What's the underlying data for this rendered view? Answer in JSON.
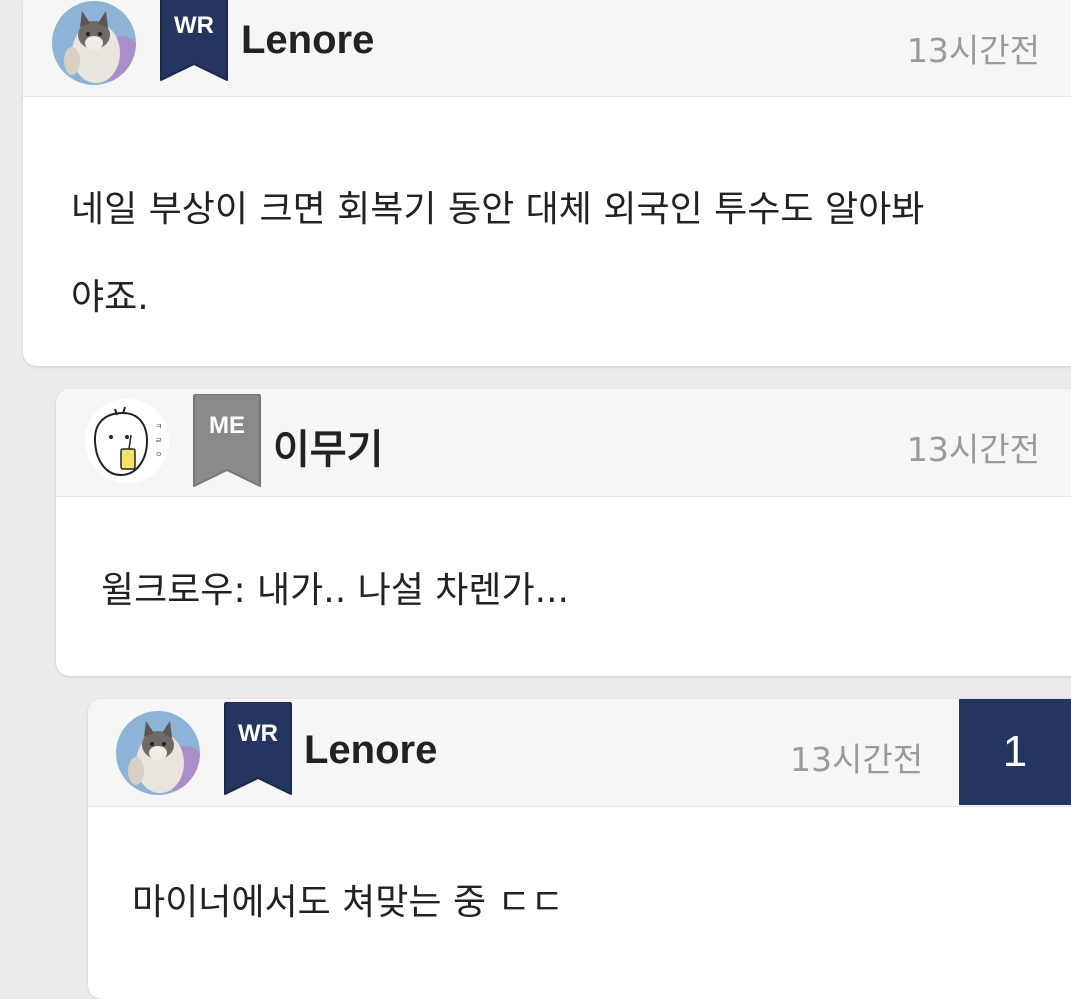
{
  "colors": {
    "writer_badge": "#24365f",
    "member_badge": "#8a8a8a",
    "reply_count_bg": "#24365f"
  },
  "comments": [
    {
      "badge": "WR",
      "author": "Lenore",
      "time": "13시간전",
      "text_lines": [
        "네일 부상이 크면 회복기 동안 대체 외국인 투수도 알아봐",
        "야죠."
      ],
      "avatar": "cat-avatar"
    },
    {
      "badge": "ME",
      "author": "이무기",
      "time": "13시간전",
      "text": "윌크로우: 내가.. 나설 차렌가...",
      "avatar": "doodle-avatar"
    },
    {
      "badge": "WR",
      "author": "Lenore",
      "time": "13시간전",
      "text": "마이너에서도 쳐맞는 중 ㄷㄷ",
      "avatar": "cat-avatar",
      "reply_count": "1"
    }
  ]
}
